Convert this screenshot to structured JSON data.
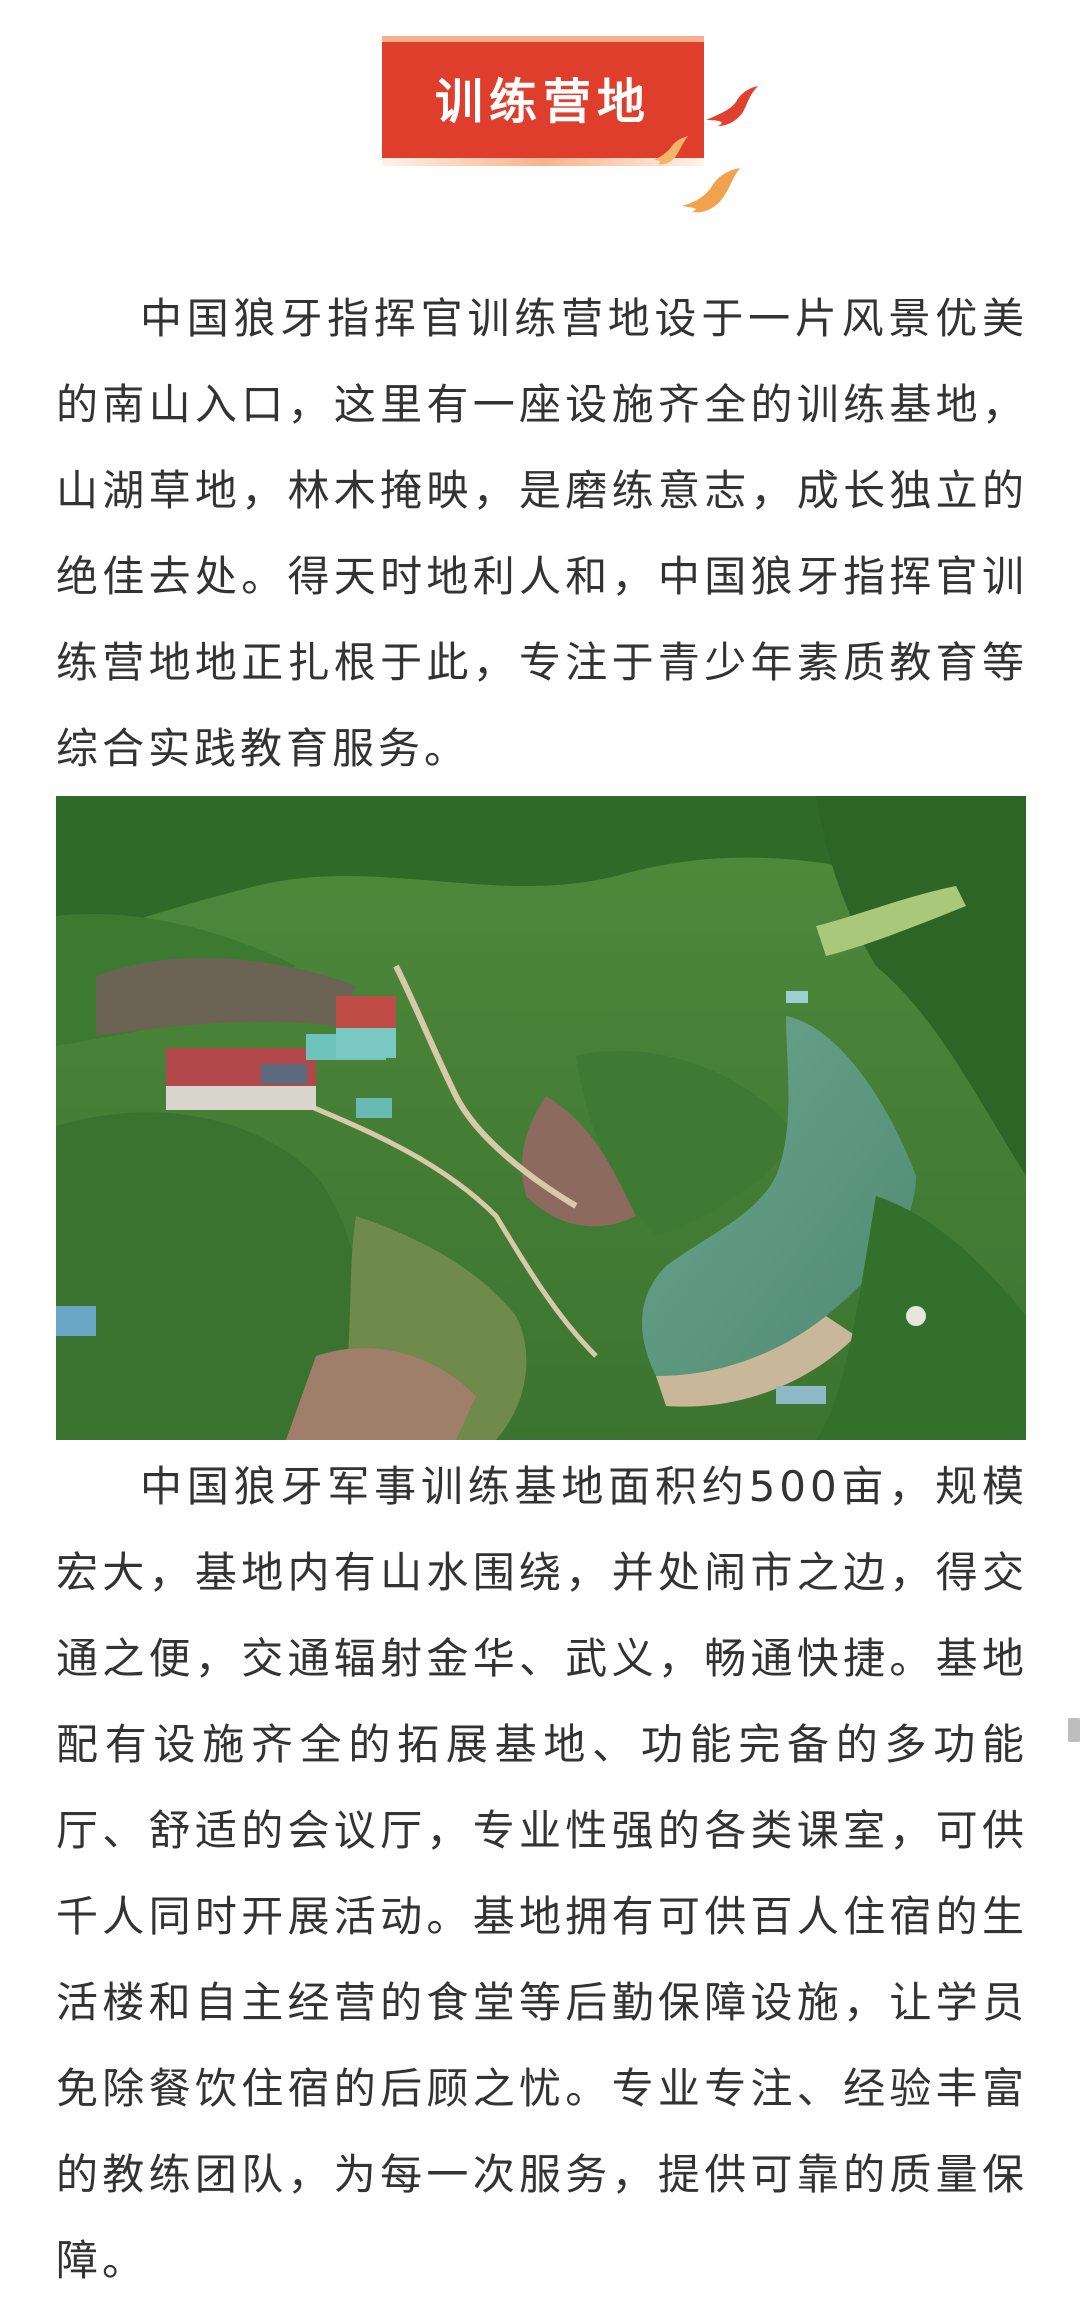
{
  "header": {
    "title": "训练营地"
  },
  "paragraphs": {
    "intro": "中国狼牙指挥官训练营地设于一片风景优美的南山入口，这里有一座设施齐全的训练基地，山湖草地，林木掩映，是磨练意志，成长独立的绝佳去处。得天时地利人和，中国狼牙指挥官训练营地地正扎根于此，专注于青少年素质教育等综合实践教育服务。",
    "facilities": "中国狼牙军事训练基地面积约500亩，规模宏大，基地内有山水围绕，并处闹市之边，得交通之便，交通辐射金华、武义，畅通快捷。基地配有设施齐全的拓展基地、功能完备的多功能厅、舒适的会议厅，专业性强的各类课室，可供千人同时开展活动。基地拥有可供百人住宿的生活楼和自主经营的食堂等后勤保障设施，让学员免除餐饮住宿的后顾之忧。专业专注、经验丰富的教练团队，为每一次服务，提供可靠的质量保障。"
  },
  "colors": {
    "badge_red": "#e03e2d",
    "bird_red": "#e0402e",
    "bird_orange": "#f0a24c",
    "text": "#333333"
  },
  "icons": {
    "birds": [
      "bird-icon",
      "bird-icon",
      "bird-icon"
    ]
  }
}
